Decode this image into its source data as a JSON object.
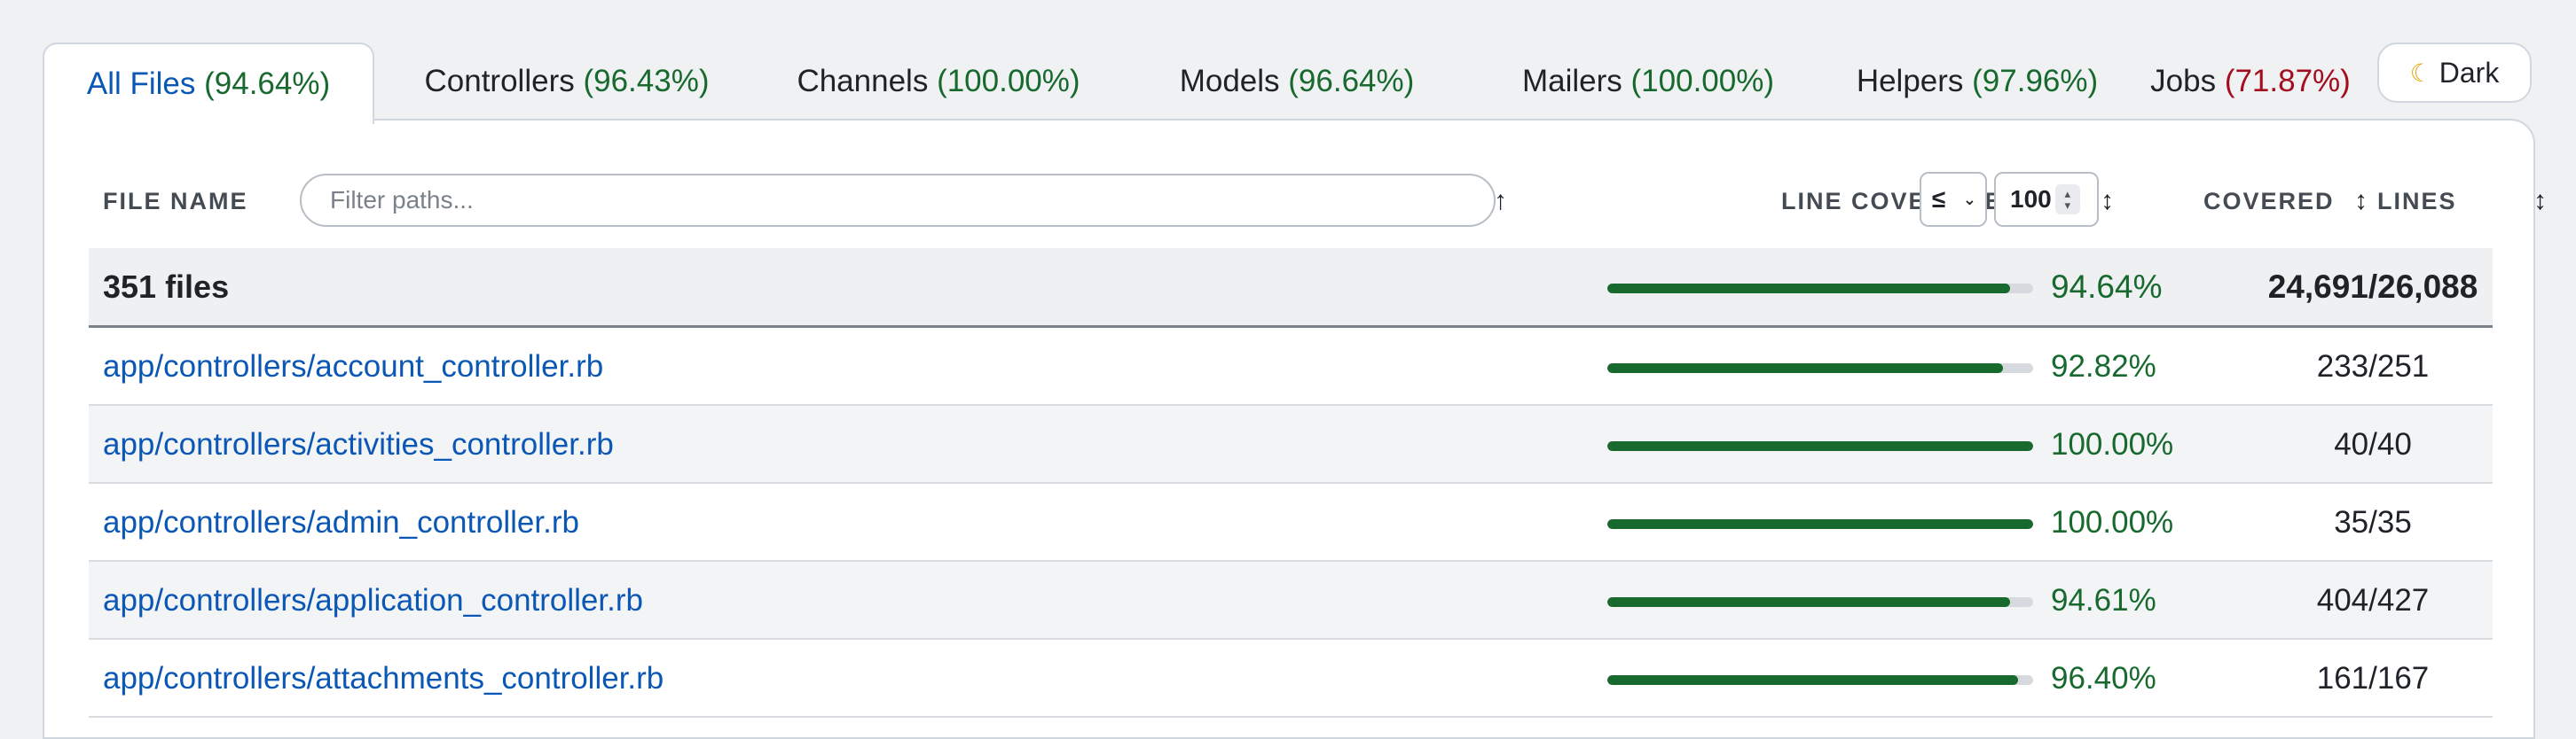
{
  "tabs": [
    {
      "name": "All Files",
      "pct": "(94.64%)",
      "status": "green",
      "active": true
    },
    {
      "name": "Controllers",
      "pct": "(96.43%)",
      "status": "green"
    },
    {
      "name": "Channels",
      "pct": "(100.00%)",
      "status": "green"
    },
    {
      "name": "Models",
      "pct": "(96.64%)",
      "status": "green"
    },
    {
      "name": "Mailers",
      "pct": "(100.00%)",
      "status": "green"
    },
    {
      "name": "Helpers",
      "pct": "(97.96%)",
      "status": "green"
    },
    {
      "name": "Jobs",
      "pct": "(71.87%)",
      "status": "red"
    }
  ],
  "theme_toggle": {
    "icon": "moon-icon",
    "label": "Dark"
  },
  "table": {
    "headers": {
      "file_name": "FILE NAME",
      "line_coverage": "LINE COVERAGE",
      "covered_lines": "COVERED",
      "lines": "LINES"
    },
    "filter_placeholder": "Filter paths...",
    "operator": "≤",
    "threshold": "100",
    "summary": {
      "label": "351 files",
      "coverage": 94.64,
      "coverage_text": "94.64%",
      "lines": "24,691/26,088"
    },
    "rows": [
      {
        "file": "app/controllers/account_controller.rb",
        "coverage": 92.82,
        "coverage_text": "92.82%",
        "lines": "233/251"
      },
      {
        "file": "app/controllers/activities_controller.rb",
        "coverage": 100.0,
        "coverage_text": "100.00%",
        "lines": "40/40"
      },
      {
        "file": "app/controllers/admin_controller.rb",
        "coverage": 100.0,
        "coverage_text": "100.00%",
        "lines": "35/35"
      },
      {
        "file": "app/controllers/application_controller.rb",
        "coverage": 94.61,
        "coverage_text": "94.61%",
        "lines": "404/427"
      },
      {
        "file": "app/controllers/attachments_controller.rb",
        "coverage": 96.4,
        "coverage_text": "96.40%",
        "lines": "161/167"
      }
    ]
  },
  "colors": {
    "accent": "#0b57b5",
    "good": "#17692e",
    "bad": "#a30d1d"
  }
}
